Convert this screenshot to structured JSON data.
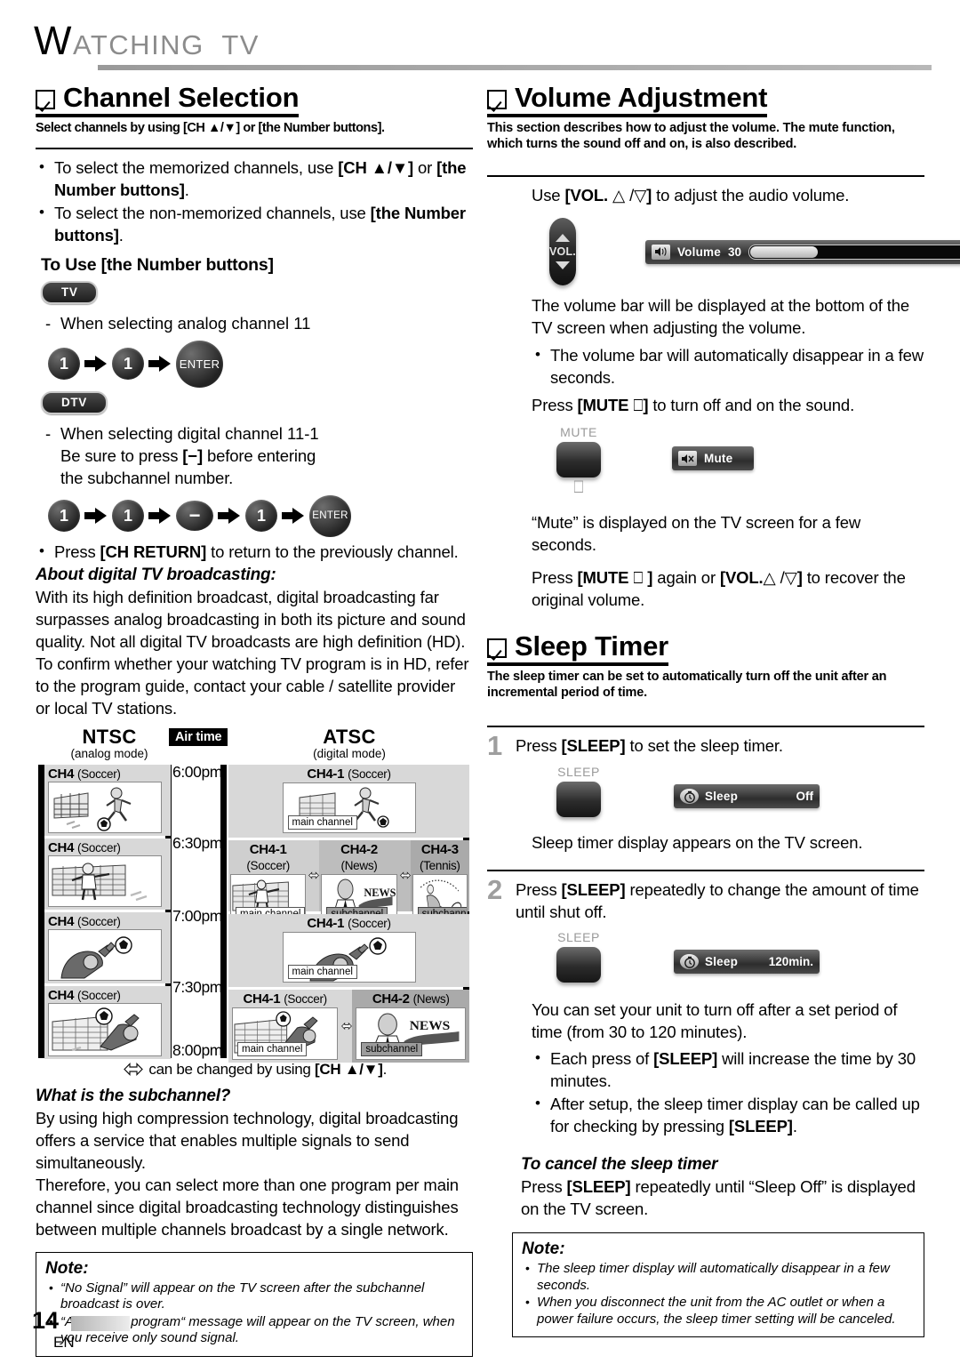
{
  "header": {
    "title_cap": "W",
    "title_rest": "ATCHING  TV"
  },
  "left": {
    "section1": {
      "title": "Channel Selection",
      "subtitle": "Select channels by using [CH ▲/▼] or [the Number buttons].",
      "bullets": [
        "To select the memorized channels, use [CH ▲/▼] or [the Number buttons].",
        "To select the non-memorized channels, use [the Number buttons]."
      ],
      "to_use_heading": "To Use [the Number buttons]",
      "tv_pill": "TV",
      "tv_line": "When selecting analog channel 11",
      "tv_sequence": [
        "1",
        "1",
        "ENTER"
      ],
      "dtv_pill": "DTV",
      "dtv_line1": "When selecting digital channel 11-1",
      "dtv_line2": "Be sure to press [−] before entering the subchannel number.",
      "dtv_sequence": [
        "1",
        "1",
        "−",
        "1",
        "ENTER"
      ],
      "ch_return_bullet": "Press [CH RETURN] to return to the previously channel.",
      "about_heading": "About digital TV broadcasting:",
      "about_body": "With its high definition broadcast, digital broadcasting far surpasses analog broadcasting in both its picture and sound quality. Not all digital TV broadcasts are high definition (HD). To confirm whether your watching TV program is in HD, refer to the program guide, contact your cable / satellite provider or local TV stations.",
      "subchannel_heading": "What is the subchannel?",
      "subchannel_body1": "By using high compression technology, digital broadcasting offers a service that enables multiple signals to send simultaneously.",
      "subchannel_body2": "Therefore, you can select more than one program per main channel since digital broadcasting technology distinguishes between multiple channels broadcast by a single network.",
      "note_title": "Note:",
      "note_items": [
        "“No Signal” will appear on the TV screen after the subchannel broadcast is over.",
        "“Audio only program“ message will appear on the TV screen, when you receive only sound signal."
      ]
    },
    "diagram": {
      "ntsc_title": "NTSC",
      "ntsc_sub": "(analog mode)",
      "atsc_title": "ATSC",
      "atsc_sub": "(digital mode)",
      "airtime_label": "Air time",
      "times": [
        "6:00pm",
        "6:30pm",
        "7:00pm",
        "7:30pm",
        "8:00pm"
      ],
      "ntsc_cells": [
        {
          "ch": "CH4",
          "genre": "(Soccer)"
        },
        {
          "ch": "CH4",
          "genre": "(Soccer)"
        },
        {
          "ch": "CH4",
          "genre": "(Soccer)"
        },
        {
          "ch": "CH4",
          "genre": "(Soccer)"
        }
      ],
      "atsc_rows": [
        {
          "cells": [
            {
              "ch": "CH4-1",
              "genre": "(Soccer)",
              "tag": "main channel",
              "tag_type": "main"
            }
          ]
        },
        {
          "cells": [
            {
              "ch": "CH4-1",
              "genre": "(Soccer)",
              "tag": "main channel",
              "tag_type": "main"
            },
            {
              "ch": "CH4-2",
              "genre": "(News)",
              "tag": "subchannel",
              "tag_type": "sub"
            },
            {
              "ch": "CH4-3",
              "genre": "(Tennis)",
              "tag": "subchannel",
              "tag_type": "sub"
            }
          ]
        },
        {
          "cells": [
            {
              "ch": "CH4-1",
              "genre": "(Soccer)",
              "tag": "main channel",
              "tag_type": "main"
            }
          ]
        },
        {
          "cells": [
            {
              "ch": "CH4-1",
              "genre": "(Soccer)",
              "tag": "main channel",
              "tag_type": "main"
            },
            {
              "ch": "CH4-2",
              "genre": "(News)",
              "tag": "subchannel",
              "tag_type": "sub"
            }
          ]
        }
      ],
      "news_word": "NEWS",
      "caption": "can be changed by using [CH ▲/▼]."
    }
  },
  "right": {
    "volume": {
      "title": "Volume Adjustment",
      "subtitle": "This section describes how to adjust the volume. The mute function, which turns the sound off and on, is also described.",
      "use_line": "Use [VOL. △ /▽] to adjust the audio volume.",
      "vol_button_label": "VOL.",
      "osd_icon": "speaker-icon",
      "osd_name": "Volume",
      "osd_value": "30",
      "osd_fill_percent": 30,
      "body1": "The volume bar will be displayed at the bottom of the TV screen when adjusting the volume.",
      "bullet1": "The volume bar will automatically disappear in a few seconds.",
      "mute_press_line": "Press [MUTE ⬚] to turn off and on the sound.",
      "mute_button_label": "MUTE",
      "mute_osd_name": "Mute",
      "mute_osd_icon": "mute-icon",
      "mute_display_line": "“Mute” is displayed on the TV screen for a few seconds.",
      "mute_recover_line": "Press [MUTE ⬚ ] again or [VOL. △ /▽] to recover the original volume."
    },
    "sleep": {
      "title": "Sleep Timer",
      "subtitle": "The sleep timer can be set to automatically turn off the unit after an incremental period of time.",
      "step1_num": "1",
      "step1_text": "Press [SLEEP] to set the sleep timer.",
      "sleep_button_label": "SLEEP",
      "osd1_name": "Sleep",
      "osd1_value": "Off",
      "osd_icon": "clock-icon",
      "step1_after": "Sleep timer display appears on the TV screen.",
      "step2_num": "2",
      "step2_text": "Press [SLEEP] repeatedly to change the amount of time until shut off.",
      "osd2_name": "Sleep",
      "osd2_value": "120min.",
      "body": "You can set your unit to turn off after a set period of time (from 30 to 120 minutes).",
      "bullets": [
        "Each press of [SLEEP] will increase the time by 30 minutes.",
        "After setup, the sleep timer display can be called up for checking by pressing [SLEEP]."
      ],
      "cancel_heading": "To cancel the sleep timer",
      "cancel_body": "Press [SLEEP] repeatedly until “Sleep Off” is displayed on the TV screen.",
      "note_title": "Note:",
      "note_items": [
        "The sleep timer display will automatically disappear in a few seconds.",
        "When you disconnect the unit from the AC outlet or when a power failure occurs, the sleep timer setting will be canceled."
      ]
    }
  },
  "footer": {
    "page_number": "14",
    "lang": "EN"
  }
}
